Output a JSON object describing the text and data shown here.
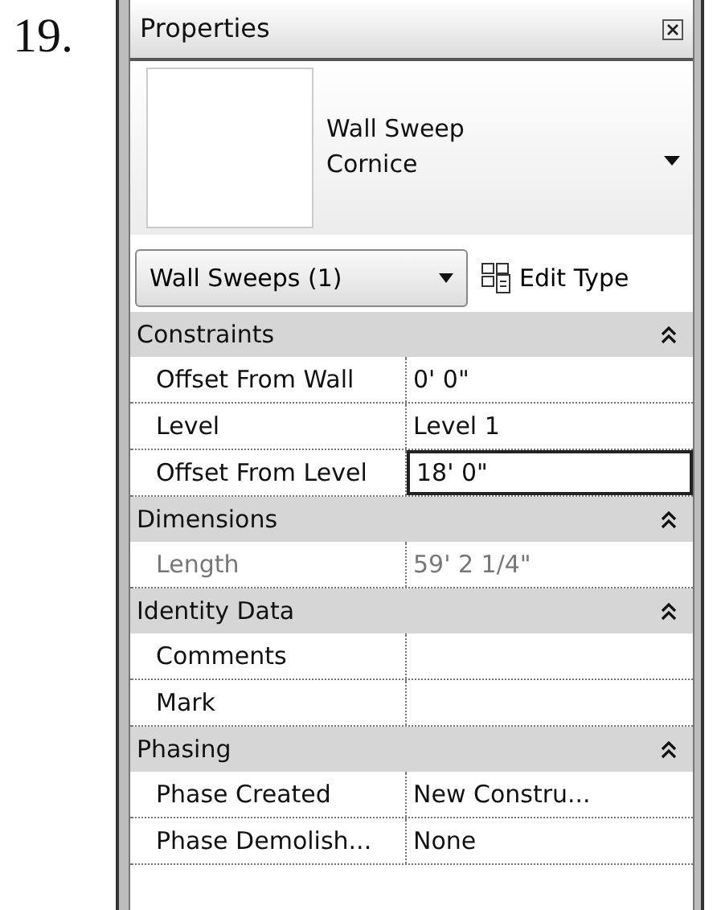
{
  "item_number": "19.",
  "palette": {
    "title": "Properties",
    "type_selector": {
      "family": "Wall Sweep",
      "type": "Cornice"
    },
    "instance_filter": {
      "value": "Wall Sweeps (1)"
    },
    "edit_type_button": "Edit Type",
    "groups": [
      {
        "name": "Constraints",
        "expanded": true,
        "rows": [
          {
            "label": "Offset From Wall",
            "value": "0'  0\"",
            "disabled": false,
            "editing": false
          },
          {
            "label": "Level",
            "value": "Level 1",
            "disabled": false,
            "editing": false
          },
          {
            "label": "Offset From Level",
            "value": "18'  0\"",
            "disabled": false,
            "editing": true
          }
        ]
      },
      {
        "name": "Dimensions",
        "expanded": true,
        "rows": [
          {
            "label": "Length",
            "value": "59'  2 1/4\"",
            "disabled": true,
            "editing": false
          }
        ]
      },
      {
        "name": "Identity Data",
        "expanded": true,
        "rows": [
          {
            "label": "Comments",
            "disabled": false,
            "editing": false
          },
          {
            "label": "Mark",
            "disabled": false,
            "editing": false
          }
        ]
      },
      {
        "name": "Phasing",
        "expanded": true,
        "rows": [
          {
            "label": "Phase Created",
            "value": "New Constru...",
            "disabled": false,
            "editing": false
          },
          {
            "label": "Phase Demolish...",
            "value": "None",
            "disabled": false,
            "editing": false
          }
        ]
      }
    ]
  }
}
